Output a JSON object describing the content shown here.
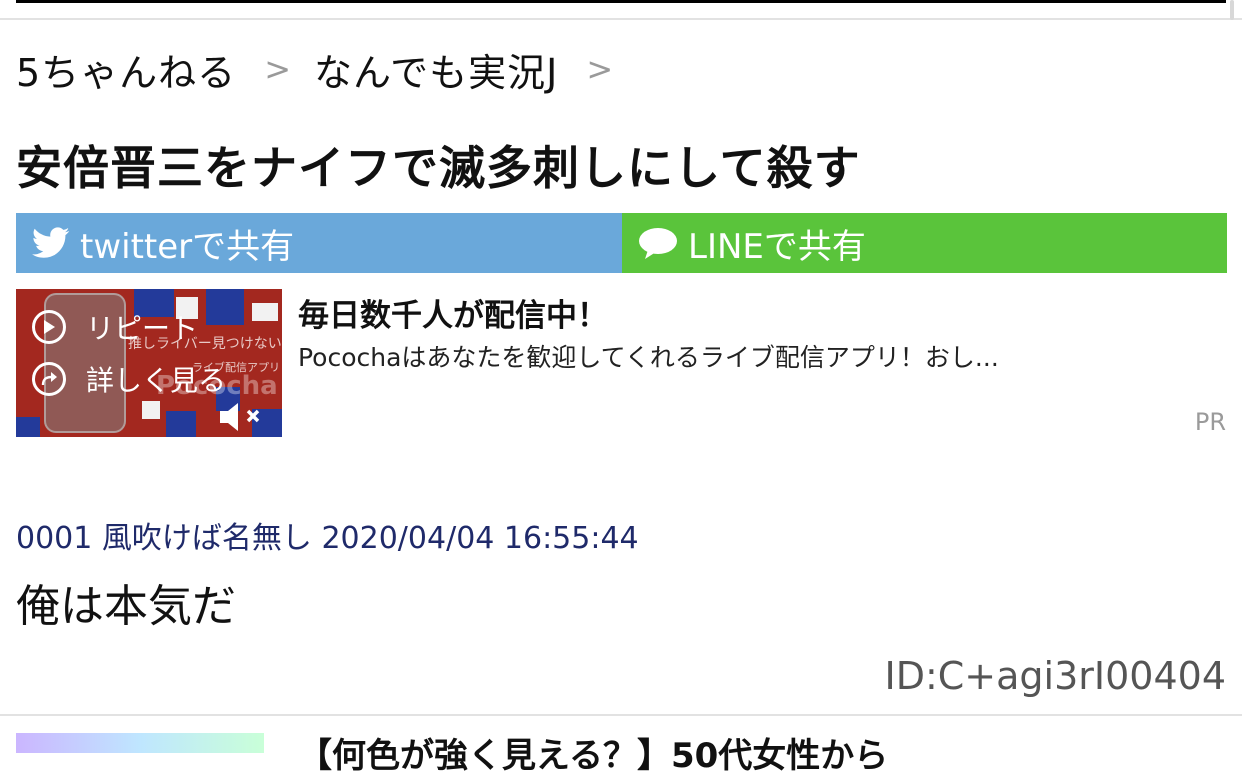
{
  "breadcrumb": {
    "site": "5ちゃんねる",
    "separator": ">",
    "board": "なんでも実況J"
  },
  "thread": {
    "title": "安倍晋三をナイフで滅多刺しにして殺す"
  },
  "share": {
    "twitter_label": "twitterで共有",
    "line_label": "LINEで共有",
    "twitter_color": "#6aa8da",
    "line_color": "#5ac43b",
    "twitter_icon": "twitter-bird-icon",
    "line_icon": "speech-bubble-icon"
  },
  "ad": {
    "repeat_label": "リピート",
    "details_label": "詳しく見る",
    "video_caption": "推しライバー見つけない?",
    "video_subcaption": "ライブ配信アプリ",
    "video_brand": "Pococha",
    "headline": "毎日数千人が配信中！",
    "description": "Pocochaはあなたを歓迎してくれるライブ配信アプリ！おし...",
    "pr_label": "PR",
    "icons": [
      "play-icon",
      "share-arrow-icon",
      "muted-speaker-icon"
    ]
  },
  "post": {
    "number": "0001",
    "name": "風吹けば名無し",
    "datetime": "2020/04/04 16:55:44",
    "body": "俺は本気だ",
    "id": "ID:C+agi3rI00404"
  },
  "next_item": {
    "title": "【何色が強く見える？】50代女性から"
  }
}
